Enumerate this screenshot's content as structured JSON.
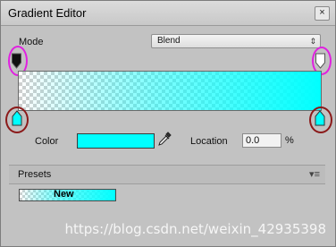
{
  "window": {
    "title": "Gradient Editor",
    "close_glyph": "×"
  },
  "mode": {
    "label": "Mode",
    "value": "Blend",
    "arrow": "⇕"
  },
  "gradient": {
    "colors": {
      "start": "#00ffff",
      "end": "#00ffff",
      "alpha_stop_start": "#111111",
      "alpha_stop_end": "#ffffff"
    },
    "icons": [
      "alpha-stop-icon",
      "color-stop-icon"
    ]
  },
  "editor": {
    "color_label": "Color",
    "color_value": "#00ffff",
    "location_label": "Location",
    "location_value": "0.0",
    "location_unit": "%"
  },
  "presets": {
    "title": "Presets",
    "menu_glyph": "▾≡",
    "items": [
      {
        "label": "New"
      }
    ]
  },
  "watermark": "https://blog.csdn.net/weixin_42935398"
}
